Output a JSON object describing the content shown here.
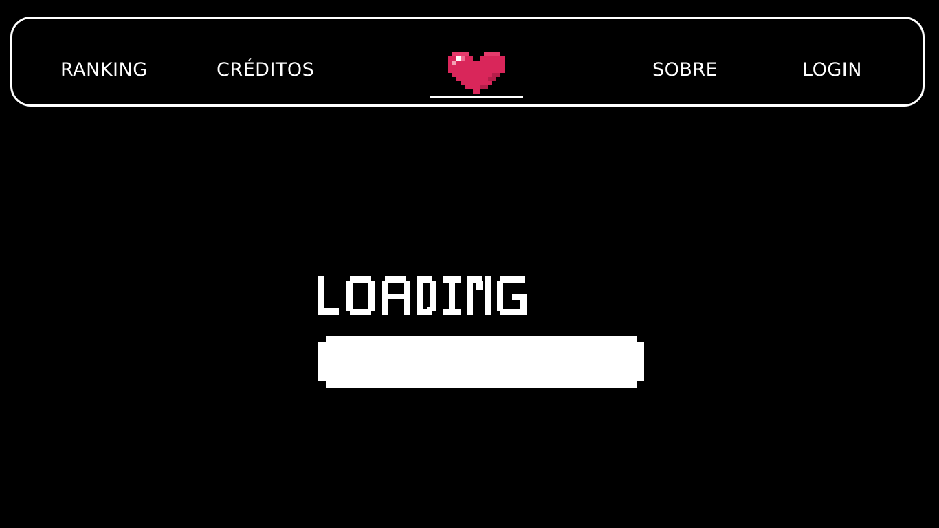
{
  "navbar": {
    "links": [
      {
        "id": "ranking",
        "label": "RANKING"
      },
      {
        "id": "creditos",
        "label": "CRÉDITOS"
      },
      {
        "id": "sobre",
        "label": "SOBRE"
      },
      {
        "id": "login",
        "label": "LOGIN"
      }
    ],
    "logo_icon": "pixel-heart-icon"
  },
  "main": {
    "loading_text": "LOADING",
    "progress": 1.0
  },
  "colors": {
    "background": "#000000",
    "foreground": "#ffffff",
    "heart_primary": "#d9265a",
    "heart_highlight": "#f4a0b4"
  }
}
